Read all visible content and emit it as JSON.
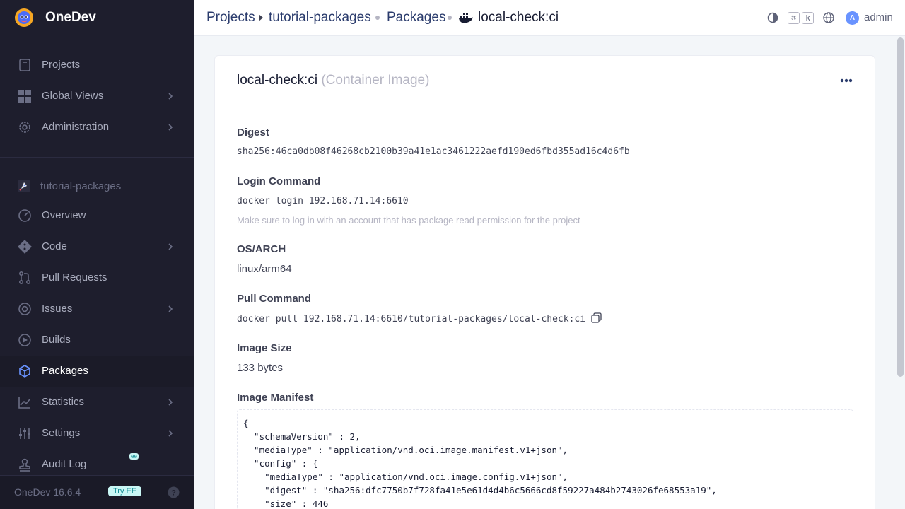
{
  "app": {
    "name": "OneDev",
    "version": "OneDev 16.6.4",
    "try_ee": "Try EE"
  },
  "sidebar": {
    "global": [
      {
        "label": "Projects",
        "icon": "projects-icon"
      },
      {
        "label": "Global Views",
        "icon": "grid-icon"
      },
      {
        "label": "Administration",
        "icon": "gear-icon"
      }
    ],
    "project_name": "tutorial-packages",
    "project_items": [
      {
        "label": "Overview",
        "icon": "gauge-icon"
      },
      {
        "label": "Code",
        "icon": "git-icon"
      },
      {
        "label": "Pull Requests",
        "icon": "pull-request-icon"
      },
      {
        "label": "Issues",
        "icon": "issue-icon"
      },
      {
        "label": "Builds",
        "icon": "play-icon"
      },
      {
        "label": "Packages",
        "icon": "package-icon",
        "active": true
      },
      {
        "label": "Statistics",
        "icon": "chart-icon"
      },
      {
        "label": "Settings",
        "icon": "sliders-icon"
      },
      {
        "label": "Audit Log",
        "icon": "stamp-icon",
        "badge": "ee"
      }
    ]
  },
  "topbar": {
    "crumbs": [
      "Projects",
      "tutorial-packages",
      "Packages"
    ],
    "current": "local-check:ci",
    "kbd": [
      "⌘",
      "k"
    ],
    "user_initial": "A",
    "user": "admin"
  },
  "package": {
    "name": "local-check:ci",
    "type": "(Container Image)",
    "digest_label": "Digest",
    "digest": "sha256:46ca0db08f46268cb2100b39a41e1ac3461222aefd190ed6fbd355ad16c4d6fb",
    "login_label": "Login Command",
    "login": "docker login 192.168.71.14:6610",
    "login_hint": "Make sure to log in with an account that has package read permission for the project",
    "os_label": "OS/ARCH",
    "os": "linux/arm64",
    "pull_label": "Pull Command",
    "pull": "docker pull 192.168.71.14:6610/tutorial-packages/local-check:ci",
    "size_label": "Image Size",
    "size": "133 bytes",
    "manifest_label": "Image Manifest",
    "manifest": "{\n  \"schemaVersion\" : 2,\n  \"mediaType\" : \"application/vnd.oci.image.manifest.v1+json\",\n  \"config\" : {\n    \"mediaType\" : \"application/vnd.oci.image.config.v1+json\",\n    \"digest\" : \"sha256:dfc7750b7f728fa41e5e61d4d4b6c5666cd8f59227a484b2743026fe68553a19\",\n    \"size\" : 446"
  },
  "colors": {
    "sidebar_bg": "#1e1e2d",
    "accent": "#2b3c6d",
    "page_bg": "#f3f6f9"
  }
}
